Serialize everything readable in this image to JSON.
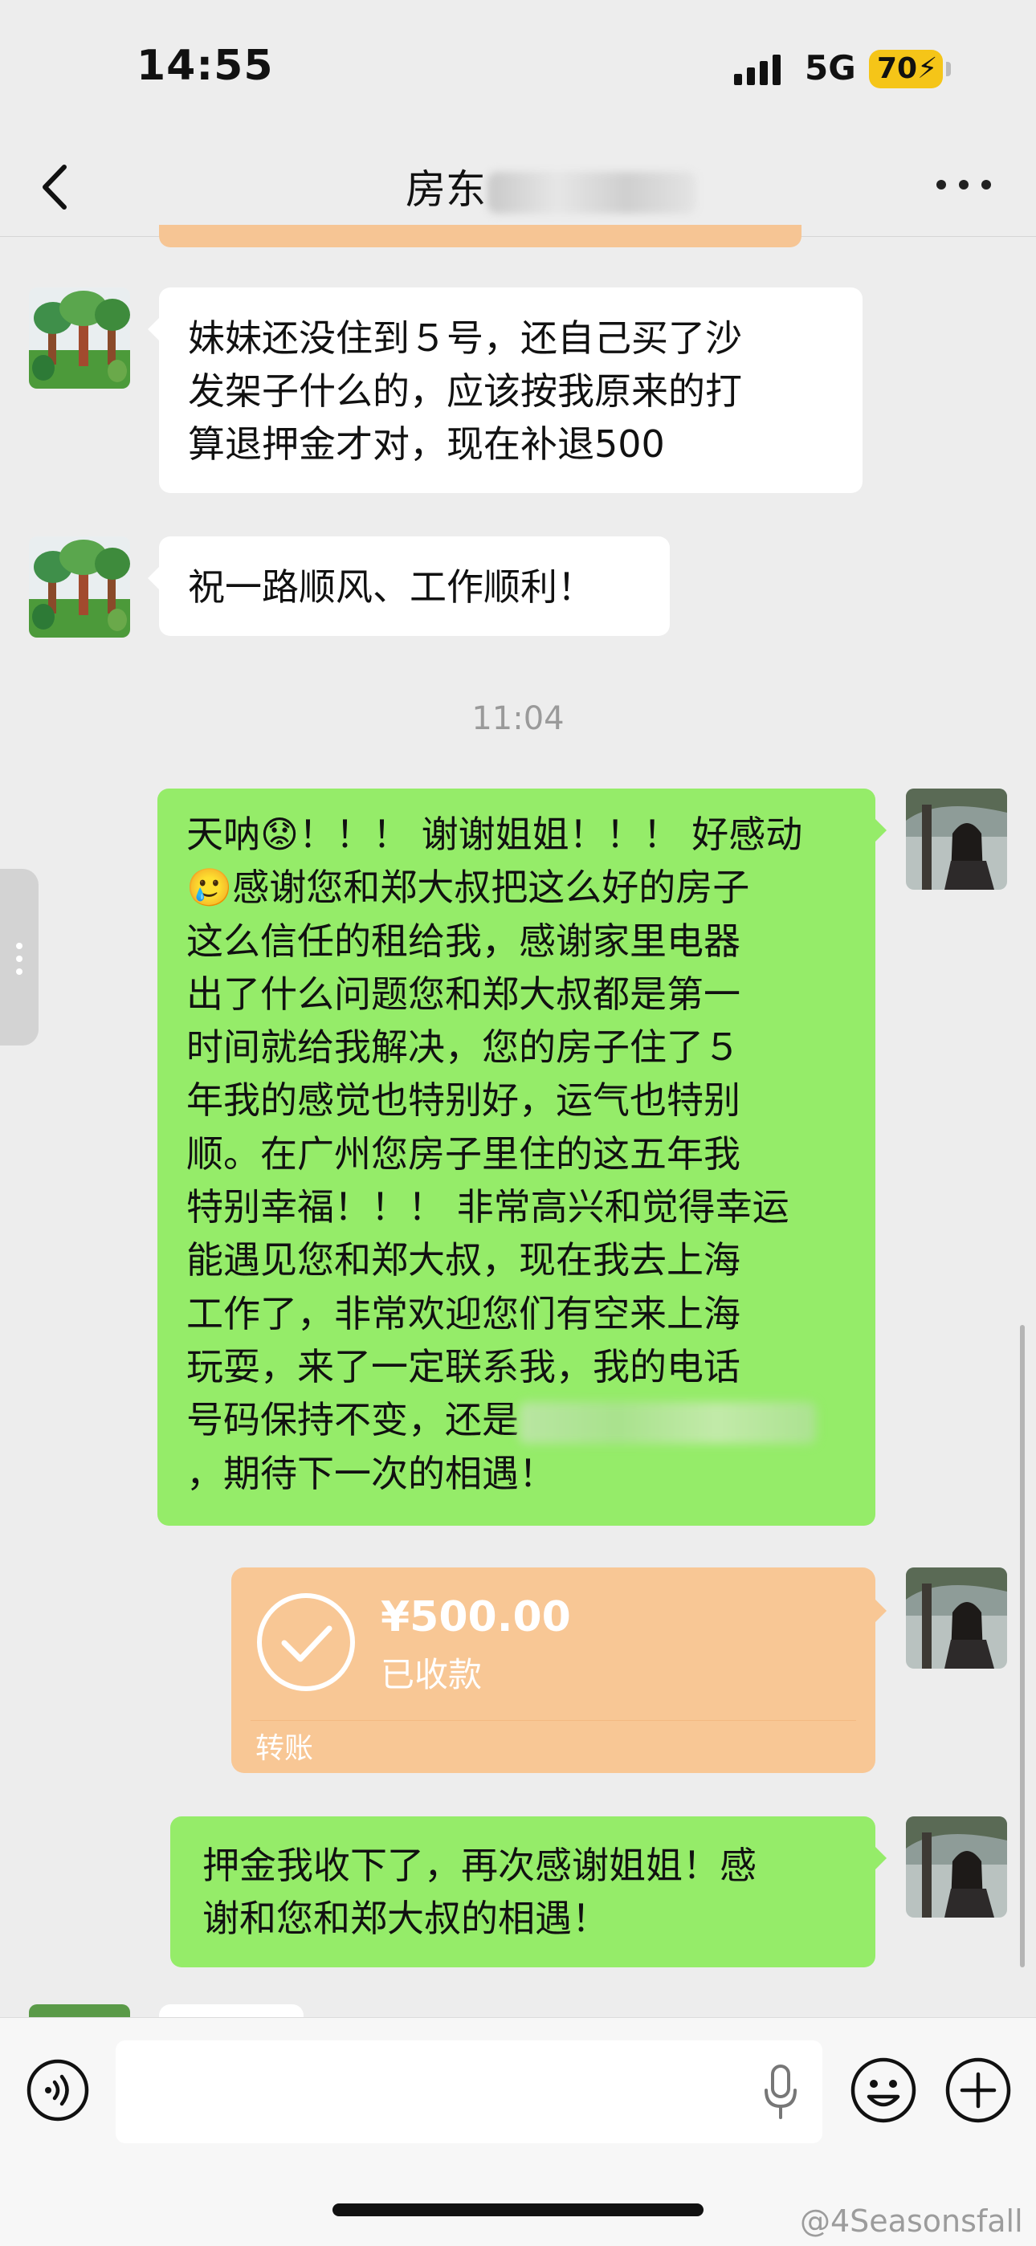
{
  "status_bar": {
    "time": "14:55",
    "network": "5G",
    "battery": "70"
  },
  "nav": {
    "title": "房东",
    "back_icon": "chevron-left-icon",
    "more_icon": "more-dots-icon"
  },
  "messages": [
    {
      "side": "in",
      "text": "妹妹还没住到５号，还自己买了沙\n发架子什么的，应该按我原来的打\n算退押金才对，现在补退500"
    },
    {
      "side": "in",
      "text": "祝一路顺风、工作顺利！"
    },
    {
      "side": "out",
      "text_before_phone": "天呐😟！！！ 谢谢姐姐！！！ 好感动\n🥲感谢您和郑大叔把这么好的房子\n这么信任的租给我，感谢家里电器\n出了什么问题您和郑大叔都是第一\n时间就给我解决，您的房子住了５\n年我的感觉也特别好，运气也特别\n顺。在广州您房子里住的这五年我\n特别幸福！！！ 非常高兴和觉得幸运\n能遇见您和郑大叔，现在我去上海\n工作了，非常欢迎您们有空来上海\n玩耍，来了一定联系我，我的电话\n号码保持不变，还是",
      "text_after_phone": "\n，期待下一次的相遇！"
    },
    {
      "side": "out",
      "text": "押金我收下了，再次感谢姐姐！感\n谢和您和郑大叔的相遇！"
    }
  ],
  "timestamp": "11:04",
  "transfer": {
    "amount": "¥500.00",
    "status": "已收款",
    "label": "转账"
  },
  "input_bar": {
    "voice_icon": "voice-icon",
    "mic_icon": "microphone-icon",
    "emoji_icon": "emoji-icon",
    "plus_icon": "plus-icon"
  },
  "watermark": "@4Seasonsfall",
  "colors": {
    "background": "#ededed",
    "outgoing_bubble": "#95ec69",
    "incoming_bubble": "#ffffff",
    "transfer_card": "#f8c795",
    "battery": "#f5c518"
  }
}
